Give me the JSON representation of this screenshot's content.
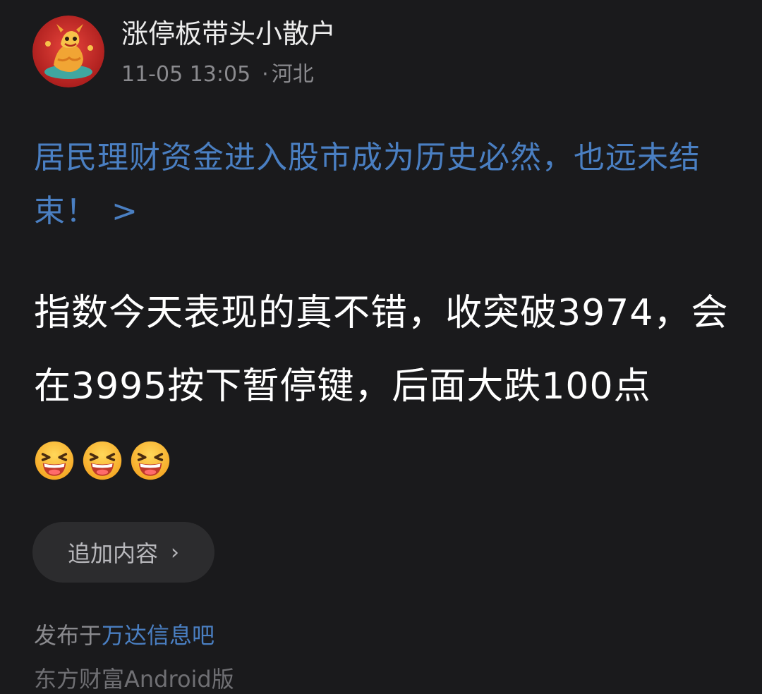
{
  "post": {
    "author": "涨停板带头小散户",
    "timestamp": "11-05 13:05",
    "separator": "·",
    "location": "河北",
    "title": "居民理财资金进入股市成为历史必然，也远未结束！",
    "title_arrow": ">",
    "content": "指数今天表现的真不错，收突破3974，会在3995按下暂停键，后面大跌100点",
    "emojis": [
      "grinning-squinting-face",
      "grinning-squinting-face",
      "grinning-squinting-face"
    ]
  },
  "actions": {
    "add_content_label": "追加内容",
    "add_content_chevron": "›"
  },
  "footer": {
    "published_prefix": "发布于",
    "forum_name": "万达信息吧",
    "source": "东方财富Android版"
  },
  "colors": {
    "background": "#1a1a1c",
    "link": "#4a7fc2",
    "text": "#ffffff",
    "muted": "#8a8a8e",
    "button_bg": "#2c2c2e"
  },
  "icons": {
    "avatar": "dragon-avatar",
    "title_arrow": "chevron-right-icon",
    "button_chevron": "chevron-right-icon"
  }
}
